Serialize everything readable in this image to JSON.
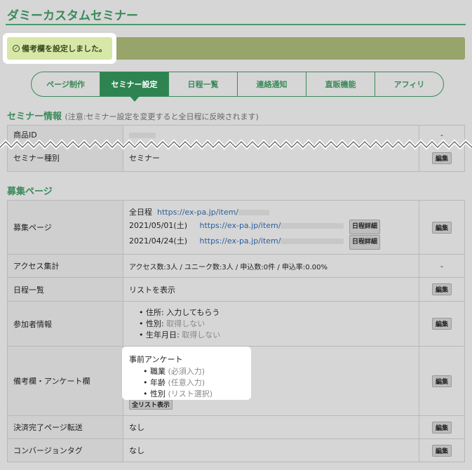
{
  "page": {
    "title": "ダミーカスタムセミナー"
  },
  "alert": {
    "message": "備考欄を設定しました。"
  },
  "tabs": [
    {
      "label": "ページ制作"
    },
    {
      "label": "セミナー設定"
    },
    {
      "label": "日程一覧"
    },
    {
      "label": "連絡通知"
    },
    {
      "label": "直販機能"
    },
    {
      "label": "アフィリ"
    }
  ],
  "seminar_info": {
    "title": "セミナー情報",
    "note": "(注意:セミナー設定を変更すると全日程に反映されます)",
    "rows": {
      "product_id": {
        "label": "商品ID",
        "action": "-"
      },
      "seminar_type": {
        "label": "セミナー種別",
        "value": "セミナー",
        "action": "編集"
      }
    }
  },
  "recruit": {
    "title": "募集ページ",
    "recruit_page": {
      "label": "募集ページ",
      "lines": [
        {
          "date": "全日程",
          "url": "https://ex-pa.jp/item/"
        },
        {
          "date": "2021/05/01(土)",
          "url": "https://ex-pa.jp/item/",
          "detail": "日程詳細"
        },
        {
          "date": "2021/04/24(土)",
          "url": "https://ex-pa.jp/item/",
          "detail": "日程詳細"
        }
      ],
      "action": "編集"
    },
    "access": {
      "label": "アクセス集計",
      "value": "アクセス数:3人 / ユニーク数:3人 / 申込数:0件 / 申込率:0.00%",
      "action": "-"
    },
    "schedule_list": {
      "label": "日程一覧",
      "value": "リストを表示",
      "action": "編集"
    },
    "participant": {
      "label": "参加者情報",
      "items": [
        {
          "name": "住所",
          "value": "入力してもらう"
        },
        {
          "name": "性別",
          "value": "取得しない"
        },
        {
          "name": "生年月日",
          "value": "取得しない"
        }
      ],
      "action": "編集"
    },
    "remarks": {
      "label": "備考欄・アンケート欄",
      "heading": "事前アンケート",
      "items": [
        {
          "name": "職業",
          "value": "(必須入力)"
        },
        {
          "name": "年齢",
          "value": "(任意入力)"
        },
        {
          "name": "性別",
          "value": "(リスト選択)"
        }
      ],
      "show_all": "全リスト表示",
      "action": "編集"
    },
    "payment_redirect": {
      "label": "決済完了ページ転送",
      "value": "なし",
      "action": "編集"
    },
    "conversion_tag": {
      "label": "コンバージョンタグ",
      "value": "なし",
      "action": "編集"
    }
  }
}
